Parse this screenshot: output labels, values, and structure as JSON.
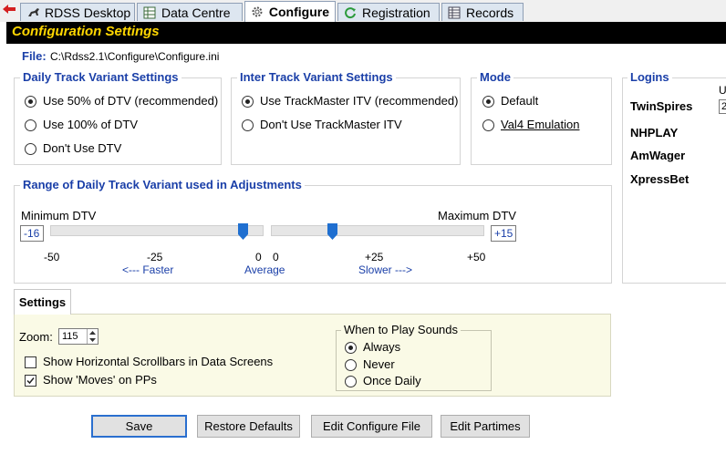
{
  "tabs": [
    {
      "label": "RDSS Desktop",
      "icon": "horse-icon"
    },
    {
      "label": "Data Centre",
      "icon": "spreadsheet-icon"
    },
    {
      "label": "Configure",
      "icon": "gear-icon",
      "active": true
    },
    {
      "label": "Registration",
      "icon": "refresh-icon"
    },
    {
      "label": "Records",
      "icon": "grid-icon"
    }
  ],
  "header": {
    "title": "Configuration Settings"
  },
  "file": {
    "label": "File:",
    "path": "C:\\Rdss2.1\\Configure\\Configure.ini"
  },
  "daily_track_variant": {
    "title": "Daily Track Variant Settings",
    "options": [
      "Use 50% of DTV (recommended)",
      "Use 100% of DTV",
      "Don't Use DTV"
    ],
    "selected": 0
  },
  "inter_track_variant": {
    "title": "Inter Track Variant Settings",
    "options": [
      "Use TrackMaster ITV (recommended)",
      "Don't Use TrackMaster ITV"
    ],
    "selected": 0
  },
  "mode": {
    "title": "Mode",
    "options": [
      "Default",
      "Val4 Emulation"
    ],
    "selected": 0
  },
  "logins": {
    "title": "Logins",
    "column_header_fragment": "U",
    "field_fragment": "2",
    "providers": [
      "TwinSpires",
      "NHPLAY",
      "AmWager",
      "XpressBet"
    ]
  },
  "range": {
    "title": "Range of Daily Track Variant used in Adjustments",
    "min_label": "Minimum DTV",
    "max_label": "Maximum DTV",
    "min_value": "-16",
    "max_value": "+15",
    "min_scale": {
      "ticks": [
        "-50",
        "-25",
        "0"
      ],
      "from": -50,
      "to": 0,
      "value": -16
    },
    "max_scale": {
      "ticks": [
        "0",
        "+25",
        "+50"
      ],
      "from": 0,
      "to": 50,
      "value": 15
    },
    "faster_label": "<--- Faster",
    "average_label": "Average",
    "slower_label": "Slower --->"
  },
  "settings": {
    "tab_label": "Settings",
    "zoom_label": "Zoom:",
    "zoom_value": "115",
    "checkboxes": [
      {
        "label": "Show Horizontal Scrollbars in Data Screens",
        "checked": false
      },
      {
        "label": "Show 'Moves' on PPs",
        "checked": true
      }
    ],
    "sounds": {
      "title": "When to Play Sounds",
      "options": [
        "Always",
        "Never",
        "Once Daily"
      ],
      "selected": 0
    }
  },
  "buttons": {
    "save": "Save",
    "restore": "Restore Defaults",
    "edit_config": "Edit Configure File",
    "edit_partimes": "Edit Partimes"
  },
  "colors": {
    "accent_blue": "#1a3fa8",
    "header_bg": "#000000",
    "header_text": "#ffd700",
    "slider_thumb": "#1f6fd0",
    "settings_panel": "#fafae6"
  }
}
